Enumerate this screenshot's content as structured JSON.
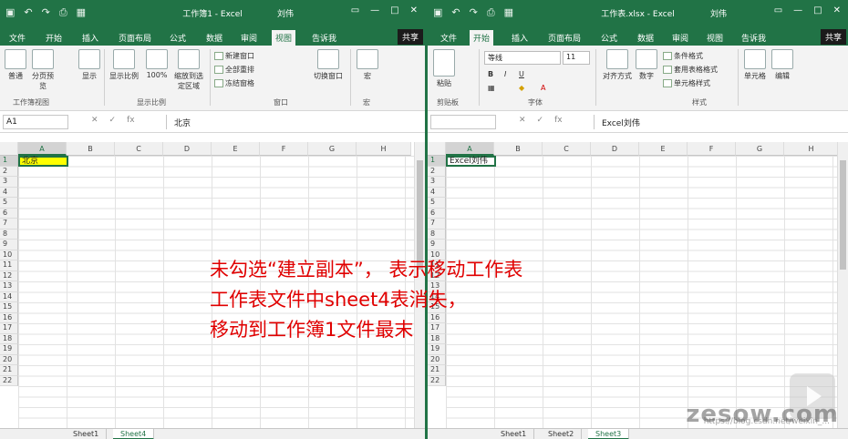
{
  "left": {
    "title": "工作簿1 - Excel",
    "user": "刘伟",
    "tabs": [
      "文件",
      "开始",
      "插入",
      "页面布局",
      "公式",
      "数据",
      "审阅",
      "视图",
      "告诉我"
    ],
    "share": "共享",
    "ribbon": {
      "normal": "普通",
      "pagebreak": "分页预览",
      "show": "显示",
      "zoom": "显示比例",
      "zoom100": "100%",
      "zoomsel": "缩放到选定区域",
      "newwin": "新建窗口",
      "arrange": "全部重排",
      "freeze": "冻结窗格",
      "switch": "切换窗口",
      "macro": "宏",
      "g1": "工作簿视图",
      "g2": "显示比例",
      "g3": "窗口",
      "g4": "宏"
    },
    "namebox": "A1",
    "formula": "北京",
    "cols": [
      "A",
      "B",
      "C",
      "D",
      "E",
      "F",
      "G",
      "H"
    ],
    "rows": [
      "1",
      "2",
      "3",
      "4",
      "5",
      "6",
      "7",
      "8",
      "9",
      "10",
      "11",
      "12",
      "13",
      "14",
      "15",
      "16",
      "17",
      "18",
      "19",
      "20",
      "21",
      "22"
    ],
    "a1": "北京",
    "sheets": [
      "Sheet1",
      "Sheet4"
    ],
    "active_sheet": "Sheet4"
  },
  "right": {
    "title": "工作表.xlsx - Excel",
    "user": "刘伟",
    "tabs": [
      "文件",
      "开始",
      "插入",
      "页面布局",
      "公式",
      "数据",
      "审阅",
      "视图",
      "告诉我"
    ],
    "share": "共享",
    "ribbon": {
      "paste": "粘贴",
      "font": "等线",
      "size": "11",
      "bold": "B",
      "italic": "I",
      "underline": "U",
      "align": "对齐方式",
      "number": "数字",
      "cond": "条件格式",
      "table": "套用表格格式",
      "style": "单元格样式",
      "cells": "单元格",
      "edit": "编辑",
      "g1": "剪贴板",
      "g2": "字体",
      "g3": "样式"
    },
    "namebox": "",
    "formula": "Excel刘伟",
    "cols": [
      "A",
      "B",
      "C",
      "D",
      "E",
      "F",
      "G",
      "H"
    ],
    "rows": [
      "1",
      "2",
      "3",
      "4",
      "5",
      "6",
      "7",
      "8",
      "9",
      "10",
      "11",
      "12",
      "13",
      "14",
      "15",
      "16",
      "17",
      "18",
      "19",
      "20",
      "21",
      "22"
    ],
    "a1": "Excel刘伟",
    "sheets": [
      "Sheet1",
      "Sheet2",
      "Sheet3"
    ],
    "active_sheet": "Sheet3"
  },
  "caption": {
    "line1": "未勾选“建立副本”， 表示移动工作表",
    "line2": "工作表文件中sheet4表消失，",
    "line3": "移动到工作簿1文件最末"
  },
  "watermark": "zesow.com",
  "url": "https://blog.csdn.net/weixin_..."
}
